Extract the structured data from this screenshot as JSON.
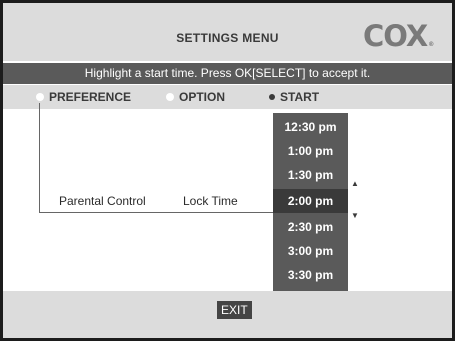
{
  "header": {
    "title": "SETTINGS MENU",
    "logo_text": "COX",
    "logo_mark": "®"
  },
  "instruction": "Highlight a start time.  Press OK[SELECT] to accept it.",
  "tabs": [
    {
      "label": "PREFERENCE",
      "state": "inactive"
    },
    {
      "label": "OPTION",
      "state": "inactive"
    },
    {
      "label": "START",
      "state": "active"
    }
  ],
  "row": {
    "label": "Parental Control",
    "setting": "Lock Time"
  },
  "time_list": {
    "items": [
      "12:30 pm",
      "1:00 pm",
      "1:30 pm",
      "2:00 pm",
      "2:30 pm",
      "3:00 pm",
      "3:30 pm"
    ],
    "selected": "2:00 pm"
  },
  "icons": {
    "scroll_up": "up-arrow",
    "scroll_down": "down-arrow"
  },
  "footer": {
    "exit_label": "EXIT"
  },
  "colors": {
    "background": "#ffffff",
    "panel_gray": "#dcdcdc",
    "instruction_bar": "#5a5a5a",
    "list_bg": "#5a5a5a",
    "selected_item": "#3a3a3a",
    "text_dark": "#3a3a3a"
  }
}
